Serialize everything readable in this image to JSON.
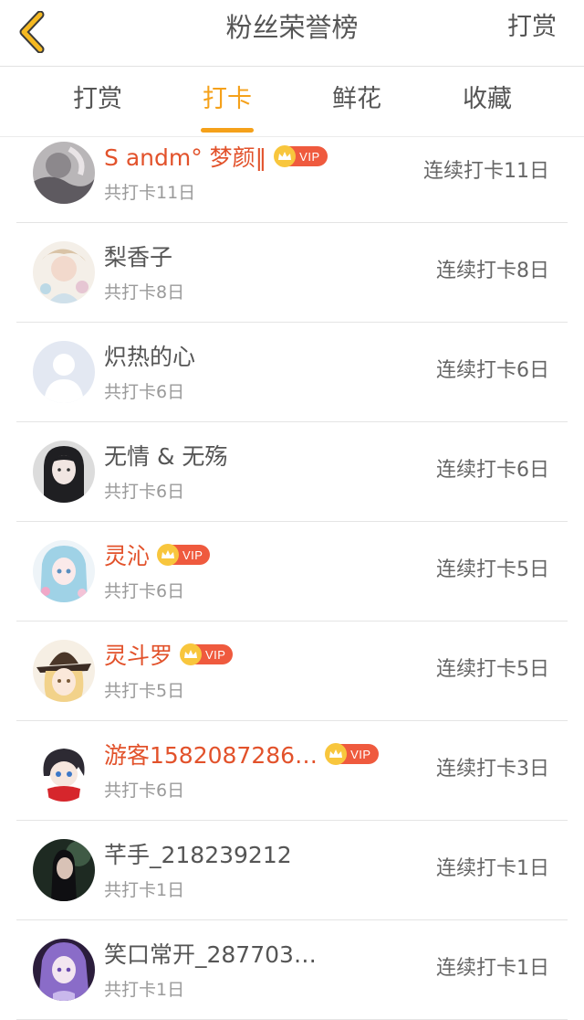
{
  "header": {
    "title": "粉丝荣誉榜",
    "right_action": "打赏"
  },
  "tabs": [
    {
      "label": "打赏",
      "active": false
    },
    {
      "label": "打卡",
      "active": true
    },
    {
      "label": "鲜花",
      "active": false
    },
    {
      "label": "收藏",
      "active": false
    }
  ],
  "colors": {
    "accent": "#f5a11a",
    "vip_name": "#e2522b",
    "vip_badge": "#ef5a3e",
    "crown": "#f8c63d"
  },
  "vip_label": "VIP",
  "fans": [
    {
      "name": "S andm° 梦颜‖",
      "vip": true,
      "total": "共打卡11日",
      "streak": "连续打卡11日",
      "avatar": "avatar-1"
    },
    {
      "name": "梨香子",
      "vip": false,
      "total": "共打卡8日",
      "streak": "连续打卡8日",
      "avatar": "avatar-2"
    },
    {
      "name": "炽热的心",
      "vip": false,
      "total": "共打卡6日",
      "streak": "连续打卡6日",
      "avatar": "default-avatar"
    },
    {
      "name": "无情 & 无殇",
      "vip": false,
      "total": "共打卡6日",
      "streak": "连续打卡6日",
      "avatar": "avatar-4"
    },
    {
      "name": "灵沁",
      "vip": true,
      "total": "共打卡6日",
      "streak": "连续打卡5日",
      "avatar": "avatar-5"
    },
    {
      "name": "灵斗罗",
      "vip": true,
      "total": "共打卡5日",
      "streak": "连续打卡5日",
      "avatar": "avatar-6"
    },
    {
      "name": "游客1582087286…",
      "vip": true,
      "total": "共打卡6日",
      "streak": "连续打卡3日",
      "avatar": "avatar-7"
    },
    {
      "name": "芊手_218239212",
      "vip": false,
      "total": "共打卡1日",
      "streak": "连续打卡1日",
      "avatar": "avatar-8"
    },
    {
      "name": "笑口常开_287703…",
      "vip": false,
      "total": "共打卡1日",
      "streak": "连续打卡1日",
      "avatar": "avatar-9"
    }
  ]
}
